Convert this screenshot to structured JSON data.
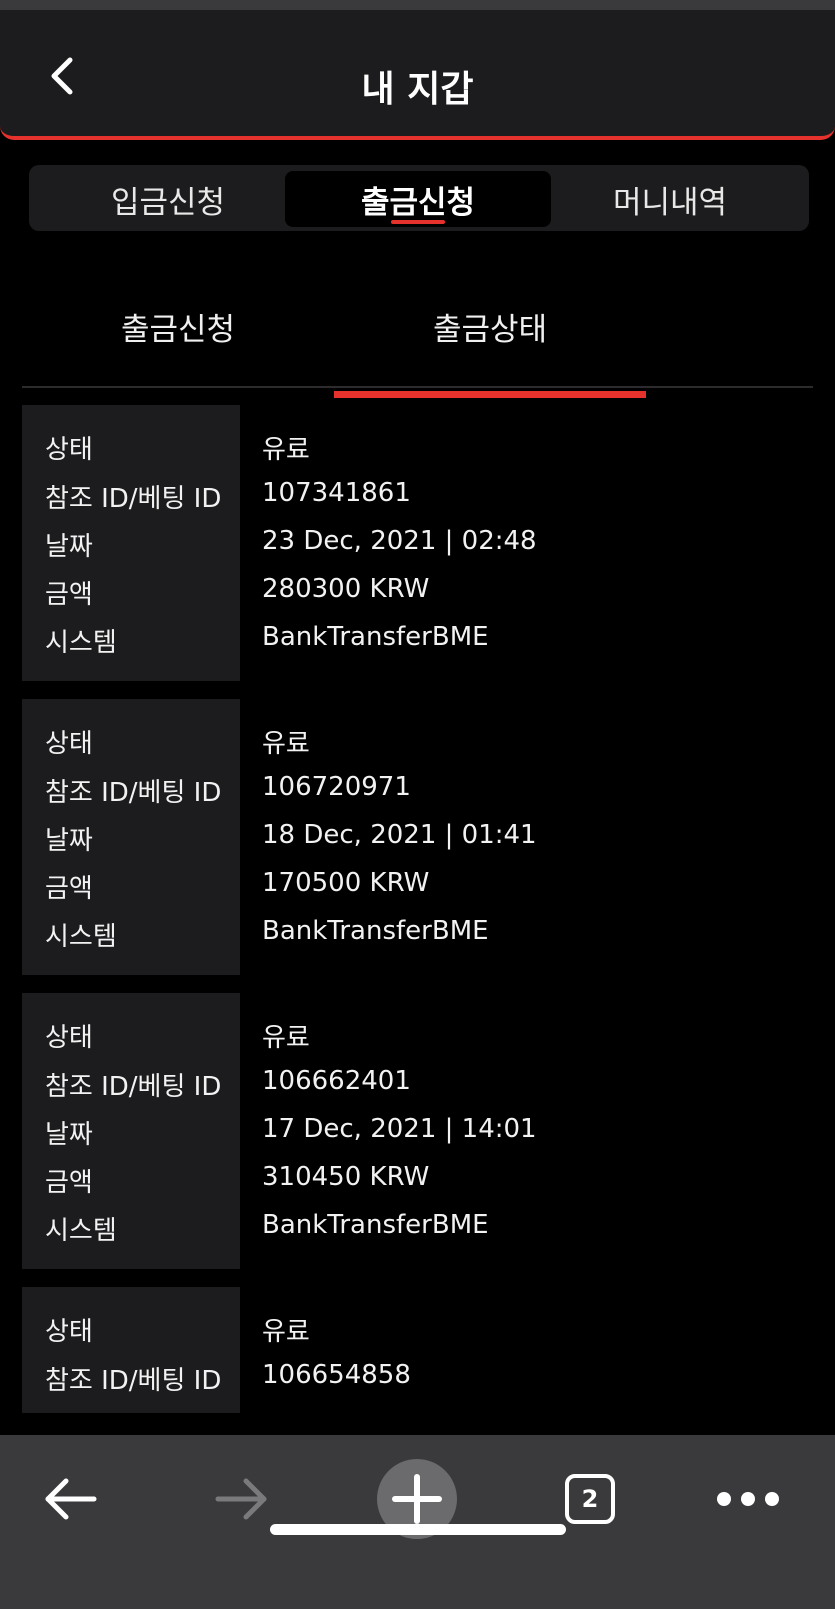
{
  "header": {
    "title": "내 지갑"
  },
  "segments": [
    {
      "label": "입금신청"
    },
    {
      "label": "출금신청"
    },
    {
      "label": "머니내역"
    }
  ],
  "subtabs": [
    {
      "label": "출금신청"
    },
    {
      "label": "출금상태"
    }
  ],
  "labels": {
    "status": "상태",
    "ref_id": "참조 ID/베팅 ID",
    "date": "날짜",
    "amount": "금액",
    "system": "시스템"
  },
  "transactions": [
    {
      "status": "유료",
      "ref_id": "107341861",
      "date": "23 Dec, 2021 | 02:48",
      "amount": "280300 KRW",
      "system": "BankTransferBME"
    },
    {
      "status": "유료",
      "ref_id": "106720971",
      "date": "18 Dec, 2021 | 01:41",
      "amount": "170500 KRW",
      "system": "BankTransferBME"
    },
    {
      "status": "유료",
      "ref_id": "106662401",
      "date": "17 Dec, 2021 | 14:01",
      "amount": "310450 KRW",
      "system": "BankTransferBME"
    },
    {
      "status": "유료",
      "ref_id": "106654858"
    }
  ],
  "browser": {
    "tab_count": "2"
  },
  "colors": {
    "accent": "#e5322d",
    "panel": "#1c1c1e",
    "toolbar": "#3a3a3c"
  }
}
